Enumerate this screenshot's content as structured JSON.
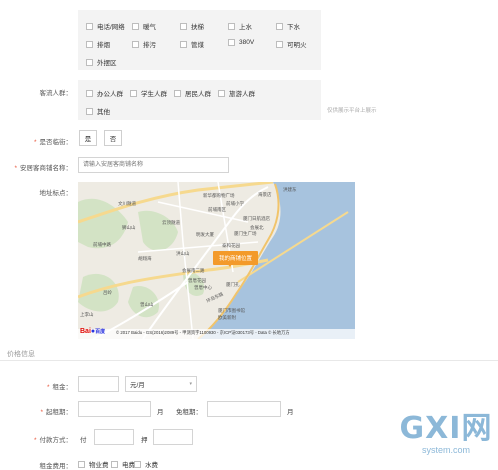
{
  "facilities": {
    "row1": [
      "电话/网络",
      "暖气",
      "扶梯",
      "上水",
      "下水"
    ],
    "row2": [
      "排烟",
      "排污",
      "管煤",
      "380V",
      "可明火"
    ],
    "row3": [
      "外摆区"
    ]
  },
  "customer_flow": {
    "label": "客流人群：",
    "options": [
      "办公人群",
      "学生人群",
      "居民人群",
      "旅游人群"
    ],
    "options2": [
      "其他"
    ],
    "note": "仅供展示平台上展示"
  },
  "brand_chain": {
    "label": "是否临街：",
    "yes": "是",
    "no": "否"
  },
  "shop_name": {
    "label": "安居客商铺名称：",
    "placeholder": "请输入安居客商铺名称"
  },
  "location": {
    "label": "地址标点：",
    "marker_label": "我的商铺位置",
    "copyright": "© 2017 Baidu - GS(2016)2089号 - 甲测资字1100930 - 京ICP证030173号 - Data © 长地万方",
    "baidu_logo": "Bai",
    "baidu_logo2": "百度",
    "places": [
      "文川隧道",
      "新华都购物广场",
      "前埔小学",
      "前埔南区",
      "厦门日航酒店",
      "会展北",
      "厦门生广场",
      "明发大厦",
      "泰和花园",
      "洪建东",
      "云顶隧道",
      "狮山山",
      "洪山山",
      "会展南二路",
      "曾厝花园",
      "曾厝中心",
      "厦门市图书馆",
      "上李山",
      "曾山山",
      "厦门孔",
      "欧美新附",
      "胡翔海",
      "海景店",
      "环岛东路",
      "吕岭",
      "前埔中路"
    ]
  },
  "price_section": {
    "title": "价格信息"
  },
  "rent": {
    "label": "租金：",
    "unit_select": "元/月"
  },
  "lease": {
    "label": "起租期：",
    "unit1": "月",
    "free_label": "免租期：",
    "unit2": "月"
  },
  "payment": {
    "label": "付款方式：",
    "pay": "付",
    "deposit": "押"
  },
  "fees": {
    "label": "租金费用：",
    "options": [
      "物业费",
      "电费",
      "水费"
    ]
  },
  "watermark": {
    "logo_text": "GXI网",
    "domain": "system.com"
  }
}
